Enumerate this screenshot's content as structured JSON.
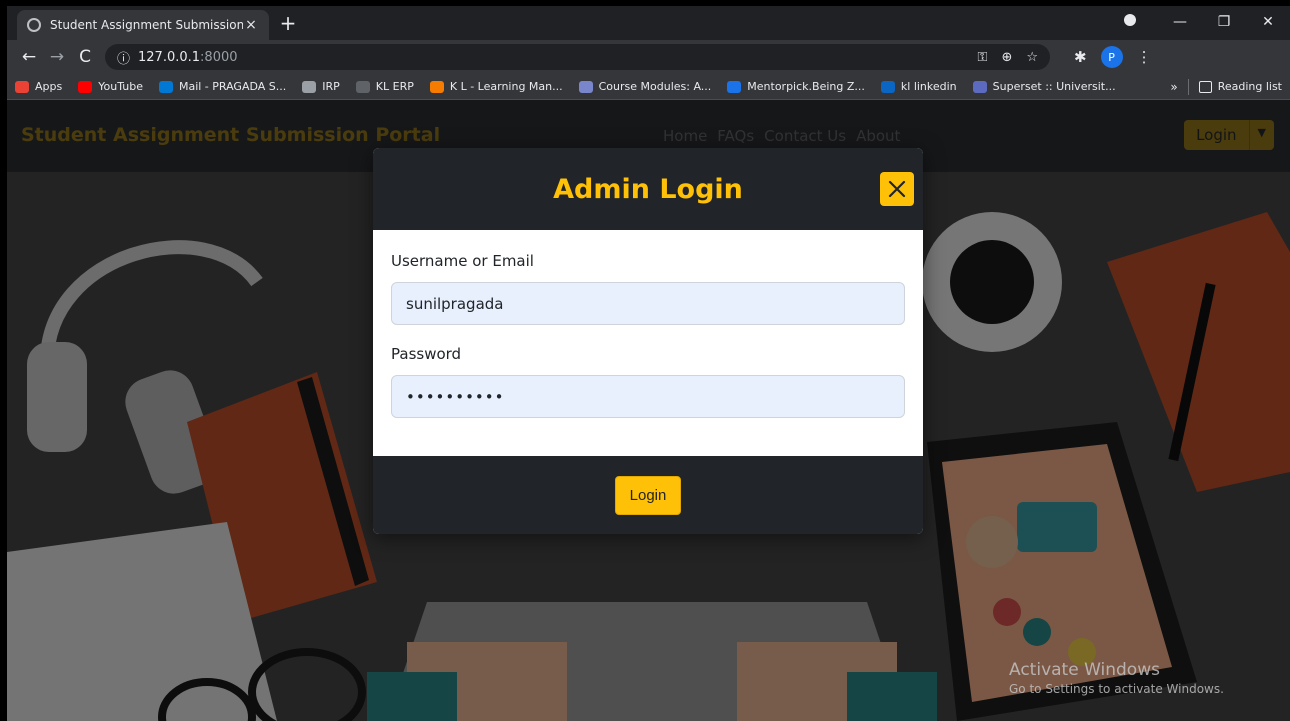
{
  "browser": {
    "tab_title": "Student Assignment Submission",
    "tab_close": "×",
    "new_tab": "+",
    "url_host": "127.0.0.1",
    "url_port": ":8000",
    "profile_initial": "P",
    "bookmarks": [
      {
        "label": "Apps",
        "color": "#ea4335"
      },
      {
        "label": "YouTube",
        "color": "#ff0000"
      },
      {
        "label": "Mail - PRAGADA S...",
        "color": "#0078d4"
      },
      {
        "label": "IRP",
        "color": "#9aa0a6"
      },
      {
        "label": "KL ERP",
        "color": "#5f6368"
      },
      {
        "label": "K L - Learning Man...",
        "color": "#f57c00"
      },
      {
        "label": "Course Modules: A...",
        "color": "#7986cb"
      },
      {
        "label": "Mentorpick.Being Z...",
        "color": "#1a73e8"
      },
      {
        "label": "kl linkedin",
        "color": "#0a66c2"
      },
      {
        "label": "Superset :: Universit...",
        "color": "#5c6bc0"
      }
    ],
    "bookmarks_overflow": "»",
    "reading_list": "Reading list"
  },
  "page": {
    "brand": "Student Assignment Submission Portal",
    "nav": [
      "Home",
      "FAQs",
      "Contact Us",
      "About"
    ],
    "login_button": "Login"
  },
  "modal": {
    "title": "Admin Login",
    "username_label": "Username or Email",
    "username_value": "sunilpragada",
    "password_label": "Password",
    "password_value": "••••••••••",
    "submit_label": "Login"
  },
  "watermark": {
    "line1": "Activate Windows",
    "line2": "Go to Settings to activate Windows."
  },
  "colors": {
    "accent": "#ffc107",
    "dark": "#212529",
    "autofill": "#e8f0fe"
  }
}
